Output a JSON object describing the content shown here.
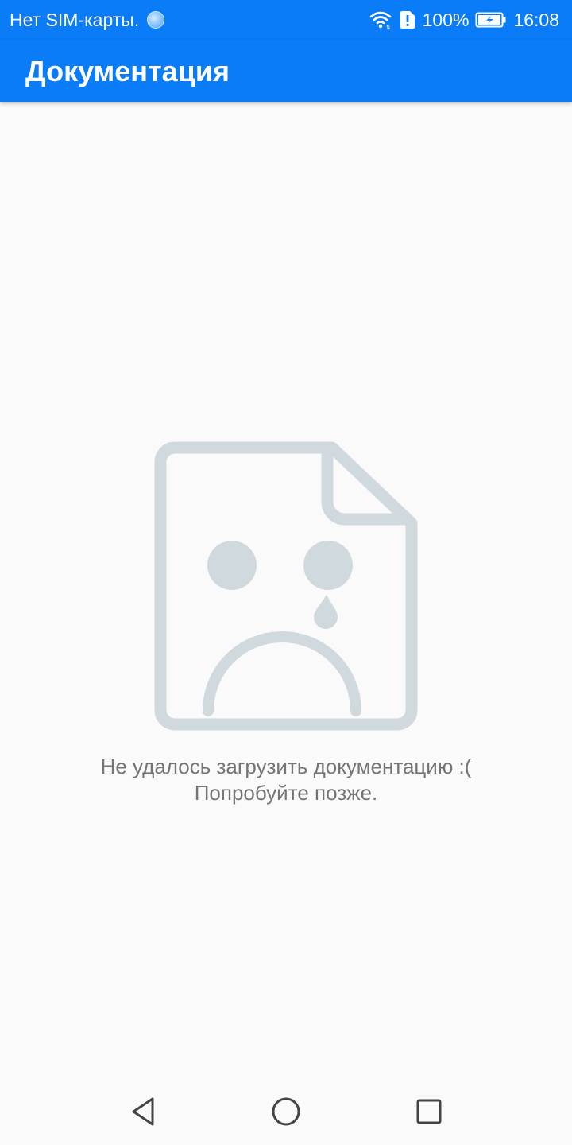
{
  "status_bar": {
    "carrier_text": "Нет SIM-карты.",
    "battery_percent": "100%",
    "time": "16:08",
    "icons": [
      "sync-icon",
      "wifi-icon",
      "alert-icon",
      "battery-charging-icon"
    ]
  },
  "app_bar": {
    "title": "Документация"
  },
  "empty_state": {
    "icon": "sad-document-icon",
    "message_line1": "Не удалось загрузить документацию :(",
    "message_line2": "Попробуйте позже."
  },
  "nav_bar": {
    "icons": [
      "back-icon",
      "home-icon",
      "recents-icon"
    ]
  },
  "colors": {
    "accent": "#0a7cf8",
    "background": "#fafafa",
    "illustration": "#d0d9de",
    "message_text": "#757575"
  }
}
